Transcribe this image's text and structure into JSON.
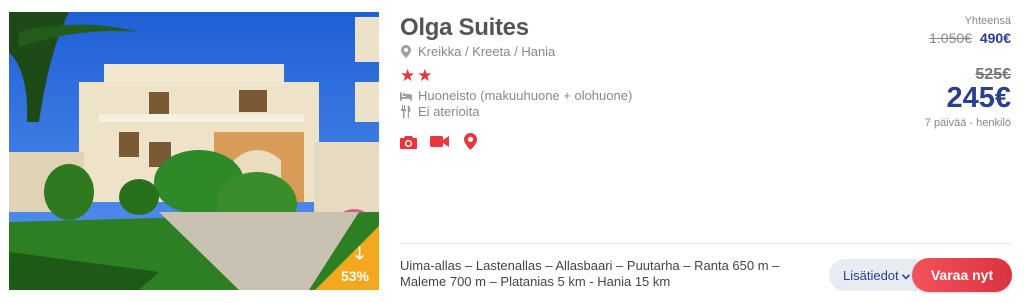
{
  "hotel": {
    "name": "Olga Suites",
    "location": "Kreikka / Kreeta / Hania",
    "stars": 2,
    "room_type": "Huoneisto (makuuhuone + olohuone)",
    "board": "Ei aterioita",
    "discount": "53%",
    "features": "Uima-allas – Lastenallas – Allasbaari – Puutarha – Ranta 650 m – Maleme 700 m – Platanias 5 km - Hania 15 km"
  },
  "icons": {
    "location": "map-marker-icon",
    "star": "star-icon",
    "room": "bed-icon",
    "board": "utensils-icon",
    "media": [
      "camera-icon",
      "video-camera-icon",
      "map-pin-icon"
    ],
    "discount": "arrow-down-icon"
  },
  "price": {
    "total_label": "Yhteensä",
    "total_old": "1.050€",
    "total_new": "490€",
    "per_person_old": "525€",
    "per_person_new": "245€",
    "per_person_note": "7 päivää - henkilö"
  },
  "actions": {
    "more_label": "Lisätiedot",
    "book_label": "Varaa nyt"
  },
  "colors": {
    "accent_red": "#e8353e",
    "price_blue": "#2b3f8f",
    "discount_orange": "#f4a81d"
  }
}
